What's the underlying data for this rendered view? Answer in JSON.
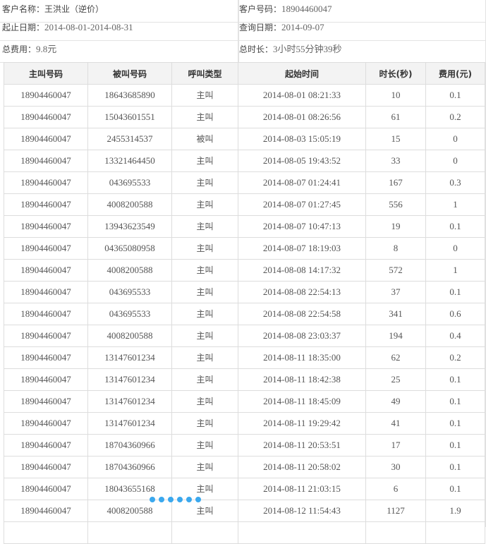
{
  "info": {
    "customer_name_label": "客户名称：",
    "customer_name": "王洪业（逆价）",
    "customer_no_label": "客户号码：",
    "customer_no": "18904460047",
    "date_range_label": "起止日期：",
    "date_range": "2014-08-01-2014-08-31",
    "query_date_label": "查询日期：",
    "query_date": "2014-09-07",
    "total_fee_label": "总费用：",
    "total_fee": "9.8元",
    "total_duration_label": "总时长：",
    "total_duration": "3小时55分钟39秒"
  },
  "table": {
    "headers": [
      "主叫号码",
      "被叫号码",
      "呼叫类型",
      "起始时间",
      "时长(秒)",
      "费用(元)"
    ],
    "rows": [
      [
        "18904460047",
        "18643685890",
        "主叫",
        "2014-08-01 08:21:33",
        "10",
        "0.1"
      ],
      [
        "18904460047",
        "15043601551",
        "主叫",
        "2014-08-01 08:26:56",
        "61",
        "0.2"
      ],
      [
        "18904460047",
        "2455314537",
        "被叫",
        "2014-08-03 15:05:19",
        "15",
        "0"
      ],
      [
        "18904460047",
        "13321464450",
        "主叫",
        "2014-08-05 19:43:52",
        "33",
        "0"
      ],
      [
        "18904460047",
        "043695533",
        "主叫",
        "2014-08-07 01:24:41",
        "167",
        "0.3"
      ],
      [
        "18904460047",
        "4008200588",
        "主叫",
        "2014-08-07 01:27:45",
        "556",
        "1"
      ],
      [
        "18904460047",
        "13943623549",
        "主叫",
        "2014-08-07 10:47:13",
        "19",
        "0.1"
      ],
      [
        "18904460047",
        "04365080958",
        "主叫",
        "2014-08-07 18:19:03",
        "8",
        "0"
      ],
      [
        "18904460047",
        "4008200588",
        "主叫",
        "2014-08-08 14:17:32",
        "572",
        "1"
      ],
      [
        "18904460047",
        "043695533",
        "主叫",
        "2014-08-08 22:54:13",
        "37",
        "0.1"
      ],
      [
        "18904460047",
        "043695533",
        "主叫",
        "2014-08-08 22:54:58",
        "341",
        "0.6"
      ],
      [
        "18904460047",
        "4008200588",
        "主叫",
        "2014-08-08 23:03:37",
        "194",
        "0.4"
      ],
      [
        "18904460047",
        "13147601234",
        "主叫",
        "2014-08-11 18:35:00",
        "62",
        "0.2"
      ],
      [
        "18904460047",
        "13147601234",
        "主叫",
        "2014-08-11 18:42:38",
        "25",
        "0.1"
      ],
      [
        "18904460047",
        "13147601234",
        "主叫",
        "2014-08-11 18:45:09",
        "49",
        "0.1"
      ],
      [
        "18904460047",
        "13147601234",
        "主叫",
        "2014-08-11 19:29:42",
        "41",
        "0.1"
      ],
      [
        "18904460047",
        "18704360966",
        "主叫",
        "2014-08-11 20:53:51",
        "17",
        "0.1"
      ],
      [
        "18904460047",
        "18704360966",
        "主叫",
        "2014-08-11 20:58:02",
        "30",
        "0.1"
      ],
      [
        "18904460047",
        "18043655168",
        "主叫",
        "2014-08-11 21:03:15",
        "6",
        "0.1"
      ],
      [
        "18904460047",
        "4008200588",
        "主叫",
        "2014-08-12 11:54:43",
        "1127",
        "1.9"
      ]
    ]
  }
}
